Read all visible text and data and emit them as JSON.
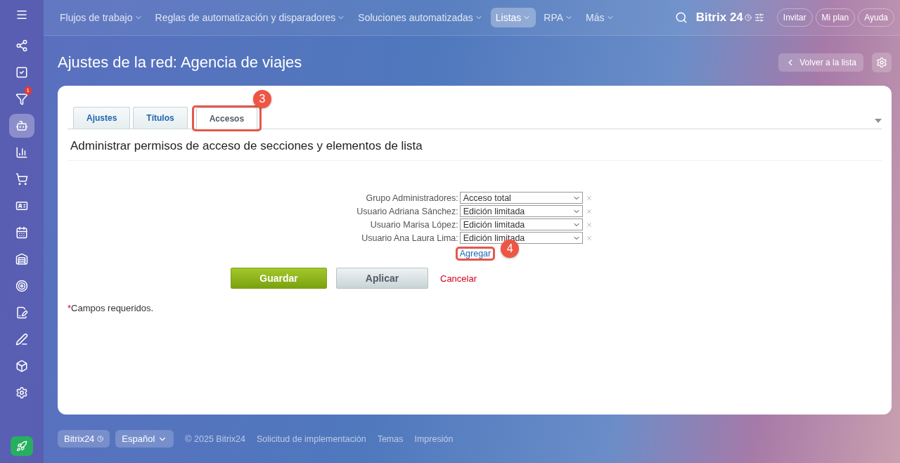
{
  "top_nav": {
    "items": [
      {
        "label": "Flujos de trabajo",
        "selected": false
      },
      {
        "label": "Reglas de automatización y disparadores",
        "selected": false
      },
      {
        "label": "Soluciones automatizadas",
        "selected": false
      },
      {
        "label": "Listas",
        "selected": true
      },
      {
        "label": "RPA",
        "selected": false
      },
      {
        "label": "Más",
        "selected": false
      }
    ],
    "logo": "Bitrix",
    "logo_number": "24",
    "buttons": [
      "Invitar",
      "Mi plan",
      "Ayuda"
    ]
  },
  "sidebar": {
    "items": [
      {
        "selected": false
      },
      {
        "selected": false
      },
      {
        "selected": false,
        "badge": "1"
      },
      {
        "selected": true
      },
      {
        "selected": false
      },
      {
        "selected": false
      },
      {
        "selected": false
      },
      {
        "selected": false
      },
      {
        "selected": false
      },
      {
        "selected": false
      },
      {
        "selected": false
      },
      {
        "selected": false
      },
      {
        "selected": false
      },
      {
        "selected": false
      }
    ]
  },
  "page": {
    "title": "Ajustes de la red: Agencia de viajes",
    "back_button": "Volver a la lista"
  },
  "tabs": [
    {
      "label": "Ajustes",
      "selected": false
    },
    {
      "label": "Títulos",
      "selected": false
    },
    {
      "label": "Accesos",
      "selected": true,
      "callout": "3"
    }
  ],
  "section_title": "Administrar permisos de acceso de secciones y elementos de lista",
  "permissions": [
    {
      "label": "Grupo Administradores:",
      "value": "Acceso total"
    },
    {
      "label": "Usuario Adriana Sánchez:",
      "value": "Edición limitada"
    },
    {
      "label": "Usuario Marisa López:",
      "value": "Edición limitada"
    },
    {
      "label": "Usuario Ana Laura Lima:",
      "value": "Edición limitada"
    }
  ],
  "add_link": {
    "label": "Agregar",
    "callout": "4"
  },
  "buttons": {
    "save": "Guardar",
    "apply": "Aplicar",
    "cancel": "Cancelar"
  },
  "required_note": {
    "mark": "*",
    "text": "Campos requeridos."
  },
  "footer": {
    "brand": "Bitrix24",
    "language": "Español",
    "copyright": "© 2025 Bitrix24",
    "links": [
      "Solicitud de implementación",
      "Temas",
      "Impresión"
    ]
  }
}
